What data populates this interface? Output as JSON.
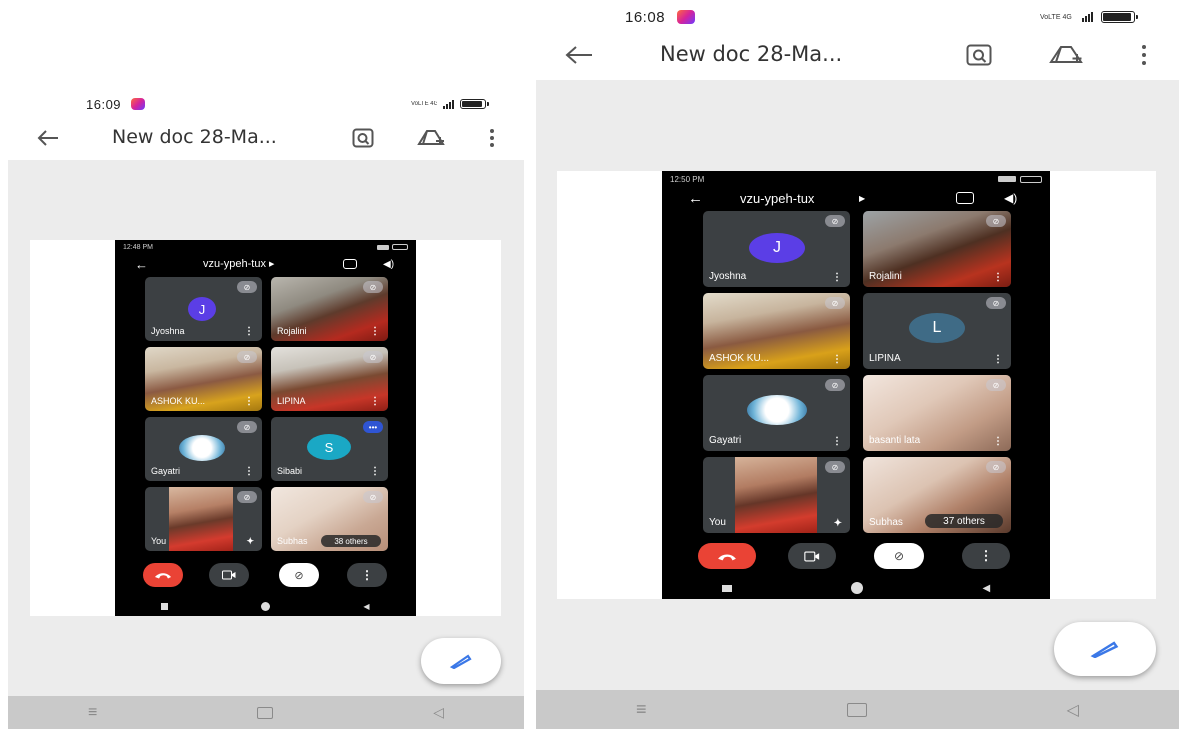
{
  "left_phone": {
    "status": {
      "time": "16:09",
      "signal_text": "VoLTE 4G"
    },
    "toolbar": {
      "title": "New doc 28-Ma..."
    },
    "meet": {
      "status_time": "12:48 PM",
      "meeting_code": "vzu-ypeh-tux",
      "tiles": [
        {
          "name": "Jyoshna",
          "initial": "J"
        },
        {
          "name": "Rojalini"
        },
        {
          "name": "ASHOK KU..."
        },
        {
          "name": "LIPINA"
        },
        {
          "name": "Gayatri"
        },
        {
          "name": "Sibabi",
          "initial": "S"
        },
        {
          "name": "You"
        },
        {
          "name": "Subhas",
          "others": "38 others"
        }
      ]
    }
  },
  "right_phone": {
    "status": {
      "time": "16:08",
      "signal_text": "VoLTE 4G"
    },
    "toolbar": {
      "title": "New doc 28-Ma..."
    },
    "meet": {
      "status_time": "12:50 PM",
      "meeting_code": "vzu-ypeh-tux",
      "tiles": [
        {
          "name": "Jyoshna",
          "initial": "J"
        },
        {
          "name": "Rojalini"
        },
        {
          "name": "ASHOK KU..."
        },
        {
          "name": "LIPINA",
          "initial": "L"
        },
        {
          "name": "Gayatri"
        },
        {
          "name": "basanti lata"
        },
        {
          "name": "You"
        },
        {
          "name": "Subhas",
          "others": "37 others"
        }
      ]
    }
  },
  "icons": {
    "back": "arrow-left-icon",
    "lens": "lens-search-icon",
    "add_to_drive": "add-to-drive-icon",
    "more": "more-vert-icon",
    "edit": "pencil-icon"
  },
  "colors": {
    "fab_icon": "#3b78e7",
    "end_call": "#ea4335",
    "avatar_purple": "#5b3ee6",
    "avatar_teal": "#1aa8c5",
    "avatar_slate": "#3f6b86",
    "viewer_bg": "#ececec",
    "navbar_bg": "#c9c9c9"
  }
}
